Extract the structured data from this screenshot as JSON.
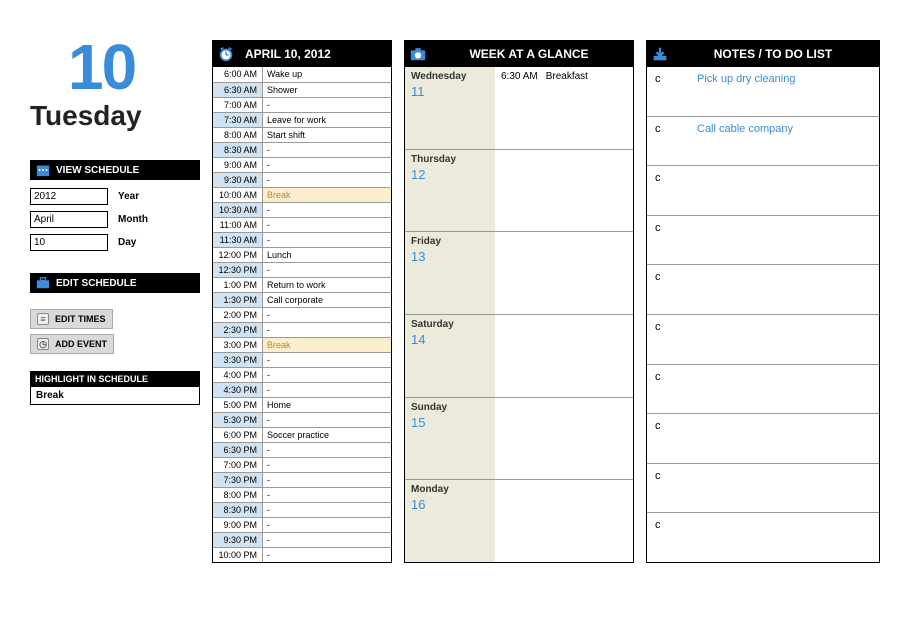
{
  "date": {
    "day_number": "10",
    "day_name": "Tuesday",
    "full": "APRIL 10, 2012"
  },
  "sidebar": {
    "view_hdr": "VIEW SCHEDULE",
    "year_label": "Year",
    "year_val": "2012",
    "month_label": "Month",
    "month_val": "April",
    "day_label": "Day",
    "day_val": "10",
    "edit_hdr": "EDIT SCHEDULE",
    "btn_times": "EDIT TIMES",
    "btn_add": "ADD EVENT",
    "hl_hdr": "HIGHLIGHT IN SCHEDULE",
    "hl_val": "Break"
  },
  "schedule": [
    {
      "time": "6:00 AM",
      "event": "Wake up",
      "shade": false
    },
    {
      "time": "6:30 AM",
      "event": "Shower",
      "shade": true
    },
    {
      "time": "7:00 AM",
      "event": "-",
      "shade": false
    },
    {
      "time": "7:30 AM",
      "event": "Leave for work",
      "shade": true
    },
    {
      "time": "8:00 AM",
      "event": "Start shift",
      "shade": false
    },
    {
      "time": "8:30 AM",
      "event": "-",
      "shade": true
    },
    {
      "time": "9:00 AM",
      "event": "-",
      "shade": false
    },
    {
      "time": "9:30 AM",
      "event": "-",
      "shade": true
    },
    {
      "time": "10:00 AM",
      "event": "Break",
      "shade": false,
      "hl": true
    },
    {
      "time": "10:30 AM",
      "event": "-",
      "shade": true
    },
    {
      "time": "11:00 AM",
      "event": "-",
      "shade": false
    },
    {
      "time": "11:30 AM",
      "event": "-",
      "shade": true
    },
    {
      "time": "12:00 PM",
      "event": "Lunch",
      "shade": false
    },
    {
      "time": "12:30 PM",
      "event": "-",
      "shade": true
    },
    {
      "time": "1:00 PM",
      "event": "Return to work",
      "shade": false
    },
    {
      "time": "1:30 PM",
      "event": "Call corporate",
      "shade": true
    },
    {
      "time": "2:00 PM",
      "event": "-",
      "shade": false
    },
    {
      "time": "2:30 PM",
      "event": "-",
      "shade": true
    },
    {
      "time": "3:00 PM",
      "event": "Break",
      "shade": false,
      "hl": true
    },
    {
      "time": "3:30 PM",
      "event": "-",
      "shade": true
    },
    {
      "time": "4:00 PM",
      "event": "-",
      "shade": false
    },
    {
      "time": "4:30 PM",
      "event": "-",
      "shade": true
    },
    {
      "time": "5:00 PM",
      "event": "Home",
      "shade": false
    },
    {
      "time": "5:30 PM",
      "event": "-",
      "shade": true
    },
    {
      "time": "6:00 PM",
      "event": "Soccer practice",
      "shade": false
    },
    {
      "time": "6:30 PM",
      "event": "-",
      "shade": true
    },
    {
      "time": "7:00 PM",
      "event": "-",
      "shade": false
    },
    {
      "time": "7:30 PM",
      "event": "-",
      "shade": true
    },
    {
      "time": "8:00 PM",
      "event": "-",
      "shade": false
    },
    {
      "time": "8:30 PM",
      "event": "-",
      "shade": true
    },
    {
      "time": "9:00 PM",
      "event": "-",
      "shade": false
    },
    {
      "time": "9:30 PM",
      "event": "-",
      "shade": true
    },
    {
      "time": "10:00 PM",
      "event": "-",
      "shade": false
    }
  ],
  "week": {
    "title": "WEEK AT A GLANCE",
    "days": [
      {
        "name": "Wednesday",
        "num": "11",
        "items": [
          {
            "time": "6:30 AM",
            "text": "Breakfast"
          }
        ]
      },
      {
        "name": "Thursday",
        "num": "12",
        "items": []
      },
      {
        "name": "Friday",
        "num": "13",
        "items": []
      },
      {
        "name": "Saturday",
        "num": "14",
        "items": []
      },
      {
        "name": "Sunday",
        "num": "15",
        "items": []
      },
      {
        "name": "Monday",
        "num": "16",
        "items": []
      }
    ]
  },
  "notes": {
    "title": "NOTES / TO DO LIST",
    "rows": [
      {
        "mark": "c",
        "text": "Pick up dry cleaning"
      },
      {
        "mark": "c",
        "text": "Call cable company"
      },
      {
        "mark": "c",
        "text": ""
      },
      {
        "mark": "c",
        "text": ""
      },
      {
        "mark": "c",
        "text": ""
      },
      {
        "mark": "c",
        "text": ""
      },
      {
        "mark": "c",
        "text": ""
      },
      {
        "mark": "c",
        "text": ""
      },
      {
        "mark": "c",
        "text": ""
      },
      {
        "mark": "c",
        "text": ""
      }
    ]
  }
}
